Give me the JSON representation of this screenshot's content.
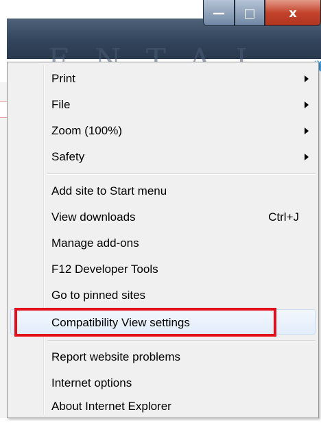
{
  "window": {
    "caption_buttons": [
      {
        "name": "minimize",
        "glyph": "—"
      },
      {
        "name": "maximize",
        "glyph": "□"
      },
      {
        "name": "close",
        "glyph": "x"
      }
    ],
    "background_text": "ENTAL"
  },
  "toolbar": {
    "home_icon": "⌂",
    "favorites_icon": "★",
    "tools_icon": "✹"
  },
  "menu": {
    "group1": [
      {
        "label": "Print",
        "submenu": true
      },
      {
        "label": "File",
        "submenu": true
      },
      {
        "label": "Zoom (100%)",
        "submenu": true
      },
      {
        "label": "Safety",
        "submenu": true
      }
    ],
    "group2": [
      {
        "label": "Add site to Start menu"
      },
      {
        "label": "View downloads",
        "shortcut": "Ctrl+J"
      },
      {
        "label": "Manage add-ons"
      },
      {
        "label": "F12 Developer Tools"
      },
      {
        "label": "Go to pinned sites"
      },
      {
        "label": "Compatibility View settings",
        "highlighted": true
      }
    ],
    "group3": [
      {
        "label": "Report website problems"
      },
      {
        "label": "Internet options"
      },
      {
        "label": "About Internet Explorer"
      }
    ]
  },
  "annotation_color": "#e3101b"
}
